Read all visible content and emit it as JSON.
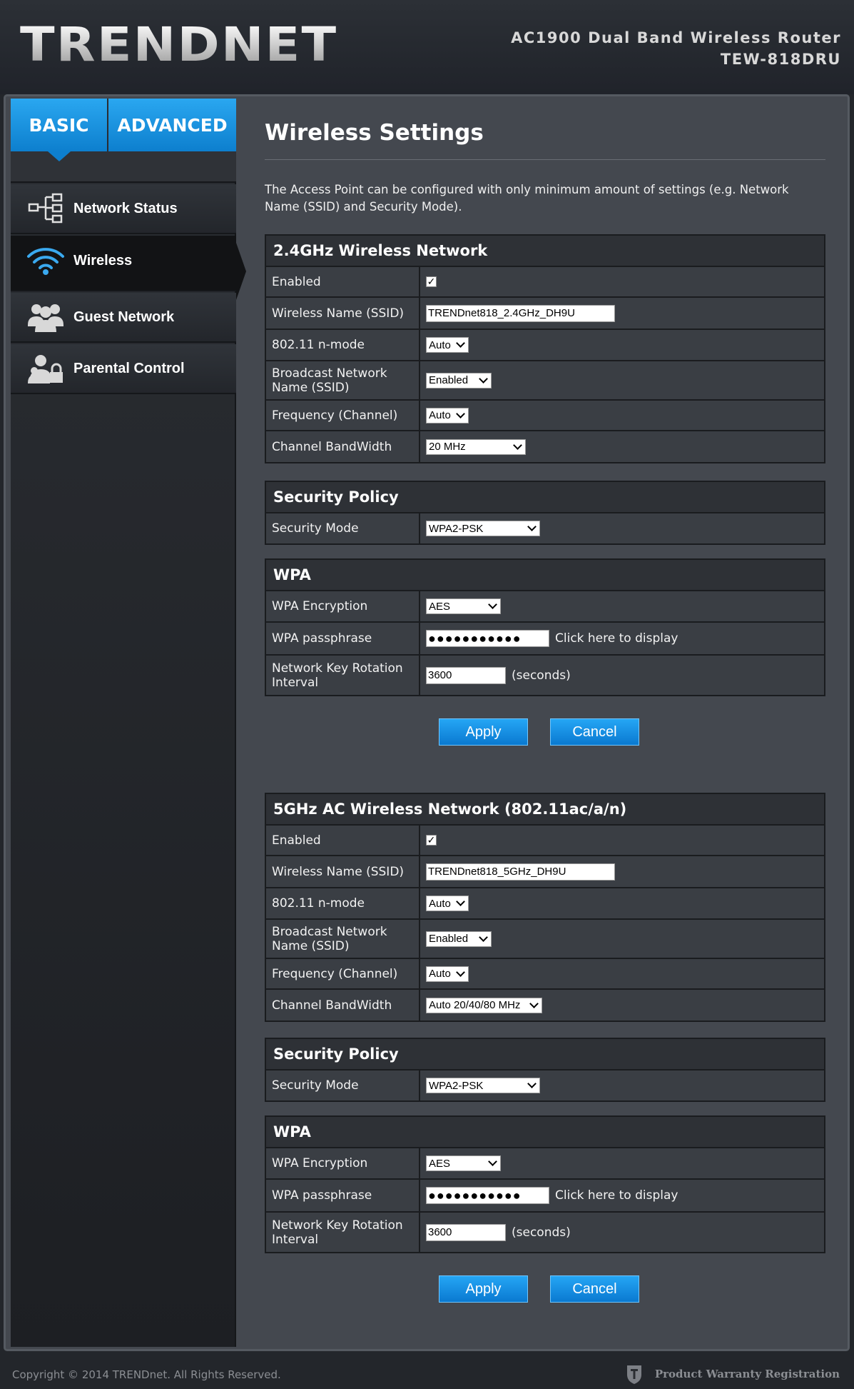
{
  "header": {
    "logo": "TRENDNET",
    "product_line1": "AC1900 Dual Band Wireless Router",
    "product_line2": "TEW-818DRU"
  },
  "tabs": {
    "basic": "BASIC",
    "advanced": "ADVANCED"
  },
  "sidebar": {
    "items": [
      {
        "label": "Network Status",
        "icon": "network-tree-icon"
      },
      {
        "label": "Wireless",
        "icon": "wifi-icon"
      },
      {
        "label": "Guest Network",
        "icon": "guests-icon"
      },
      {
        "label": "Parental Control",
        "icon": "parental-lock-icon"
      }
    ]
  },
  "main": {
    "title": "Wireless Settings",
    "intro": "The Access Point can be configured with only minimum amount of settings (e.g. Network Name (SSID) and Security Mode)."
  },
  "band24": {
    "title": "2.4GHz Wireless Network",
    "enabled_label": "Enabled",
    "enabled": true,
    "ssid_label": "Wireless Name (SSID)",
    "ssid": "TRENDnet818_2.4GHz_DH9U",
    "nmode_label": "802.11 n-mode",
    "nmode": "Auto",
    "broadcast_label": "Broadcast Network Name (SSID)",
    "broadcast": "Enabled",
    "channel_label": "Frequency (Channel)",
    "channel": "Auto",
    "bandwidth_label": "Channel BandWidth",
    "bandwidth": "20 MHz",
    "sec_title": "Security Policy",
    "sec_mode_label": "Security Mode",
    "sec_mode": "WPA2-PSK",
    "wpa_title": "WPA",
    "enc_label": "WPA Encryption",
    "enc": "AES",
    "pass_label": "WPA passphrase",
    "pass_mask": "●●●●●●●●●●●",
    "pass_hint": "Click here to display",
    "rotation_label": "Network Key Rotation Interval",
    "rotation": "3600",
    "rotation_unit": "(seconds)",
    "apply": "Apply",
    "cancel": "Cancel"
  },
  "band5": {
    "title": "5GHz AC Wireless Network (802.11ac/a/n)",
    "enabled_label": "Enabled",
    "enabled": true,
    "ssid_label": "Wireless Name (SSID)",
    "ssid": "TRENDnet818_5GHz_DH9U",
    "nmode_label": "802.11 n-mode",
    "nmode": "Auto",
    "broadcast_label": "Broadcast Network Name (SSID)",
    "broadcast": "Enabled",
    "channel_label": "Frequency (Channel)",
    "channel": "Auto",
    "bandwidth_label": "Channel BandWidth",
    "bandwidth": "Auto 20/40/80 MHz",
    "sec_title": "Security Policy",
    "sec_mode_label": "Security Mode",
    "sec_mode": "WPA2-PSK",
    "wpa_title": "WPA",
    "enc_label": "WPA Encryption",
    "enc": "AES",
    "pass_label": "WPA passphrase",
    "pass_mask": "●●●●●●●●●●●",
    "pass_hint": "Click here to display",
    "rotation_label": "Network Key Rotation Interval",
    "rotation": "3600",
    "rotation_unit": "(seconds)",
    "apply": "Apply",
    "cancel": "Cancel"
  },
  "footer": {
    "copyright": "Copyright © 2014 TRENDnet. All Rights Reserved.",
    "warranty": "Product Warranty Registration"
  },
  "colors": {
    "accent": "#0d7fce",
    "background": "#44484f",
    "panel_head": "#2e3136"
  }
}
